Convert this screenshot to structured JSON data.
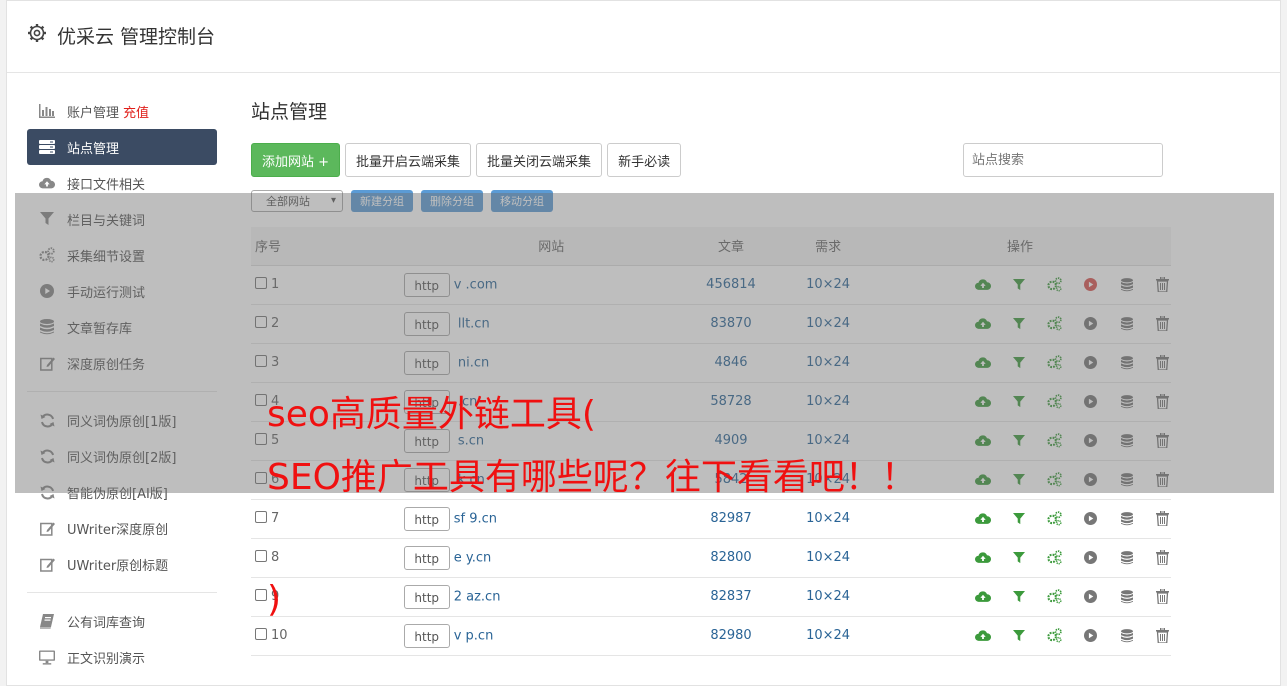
{
  "header": {
    "title": "优采云 管理控制台"
  },
  "sidebar": {
    "items": [
      {
        "label": "账户管理",
        "badge": "充值",
        "icon": "bar-chart-icon"
      },
      {
        "label": "站点管理",
        "icon": "server-icon",
        "active": true
      },
      {
        "label": "接口文件相关",
        "icon": "cloud-upload-icon"
      },
      {
        "label": "栏目与关键词",
        "icon": "filter-icon"
      },
      {
        "label": "采集细节设置",
        "icon": "gears-icon"
      },
      {
        "label": "手动运行测试",
        "icon": "play-circle-icon"
      },
      {
        "label": "文章暂存库",
        "icon": "database-icon"
      },
      {
        "label": "深度原创任务",
        "icon": "edit-icon"
      },
      {
        "label": "同义词伪原创[1版]",
        "icon": "refresh-icon"
      },
      {
        "label": "同义词伪原创[2版]",
        "icon": "refresh-icon"
      },
      {
        "label": "智能伪原创[AI版]",
        "icon": "refresh-icon"
      },
      {
        "label": "UWriter深度原创",
        "icon": "edit-icon"
      },
      {
        "label": "UWriter原创标题",
        "icon": "edit-icon"
      },
      {
        "label": "公有词库查询",
        "icon": "book-icon"
      },
      {
        "label": "正文识别演示",
        "icon": "monitor-icon"
      }
    ]
  },
  "main": {
    "title": "站点管理",
    "toolbar": {
      "add": "添加网站 +",
      "batch_on": "批量开启云端采集",
      "batch_off": "批量关闭云端采集",
      "guide": "新手必读"
    },
    "search_placeholder": "站点搜索",
    "group": {
      "select": "全部网站",
      "new": "新建分组",
      "delete": "删除分组",
      "move": "移动分组"
    },
    "table": {
      "headers": {
        "num": "序号",
        "site": "网站",
        "articles": "文章",
        "demand": "需求",
        "ops": "操作"
      },
      "rows": [
        {
          "num": "1",
          "proto": "http",
          "url": "v            .com",
          "articles": "456814",
          "demand": "10×24",
          "run_active": true
        },
        {
          "num": "2",
          "proto": "http",
          "url": "      llt.cn",
          "articles": "83870",
          "demand": "10×24"
        },
        {
          "num": "3",
          "proto": "http",
          "url": "       ni.cn",
          "articles": "4846",
          "demand": "10×24"
        },
        {
          "num": "4",
          "proto": "http",
          "url": "          .cn",
          "articles": "58728",
          "demand": "10×24"
        },
        {
          "num": "5",
          "proto": "http",
          "url": "       s.cn",
          "articles": "4909",
          "demand": "10×24"
        },
        {
          "num": "6",
          "proto": "http",
          "url": "     k.cn",
          "articles": "5842",
          "demand": "10×24"
        },
        {
          "num": "7",
          "proto": "http",
          "url": "sf  9.cn",
          "articles": "82987",
          "demand": "10×24"
        },
        {
          "num": "8",
          "proto": "http",
          "url": "e      y.cn",
          "articles": "82800",
          "demand": "10×24"
        },
        {
          "num": "9",
          "proto": "http",
          "url": "2     az.cn",
          "articles": "82837",
          "demand": "10×24"
        },
        {
          "num": "10",
          "proto": "http",
          "url": "v      p.cn",
          "articles": "82980",
          "demand": "10×24"
        }
      ]
    }
  },
  "watermark": {
    "line1": "seo高质量外链工具(",
    "line2": "SEO推广工具有哪些呢？往下看看吧！！",
    "line3": ")"
  },
  "colors": {
    "active_nav": "#3b4b63",
    "primary_btn": "#5cb85c",
    "group_btn": "#5b9bd5",
    "link": "#2a6496",
    "recharge": "#e0201b",
    "watermark": "#f01010"
  }
}
